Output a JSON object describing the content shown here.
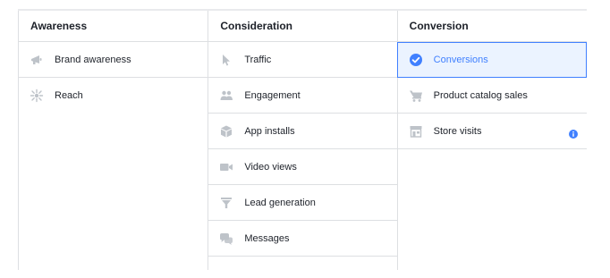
{
  "columns": {
    "awareness": {
      "title": "Awareness",
      "items": [
        {
          "label": "Brand awareness",
          "icon": "megaphone-icon"
        },
        {
          "label": "Reach",
          "icon": "reach-icon"
        }
      ]
    },
    "consideration": {
      "title": "Consideration",
      "items": [
        {
          "label": "Traffic",
          "icon": "cursor-icon"
        },
        {
          "label": "Engagement",
          "icon": "people-icon"
        },
        {
          "label": "App installs",
          "icon": "box-icon"
        },
        {
          "label": "Video views",
          "icon": "video-camera-icon"
        },
        {
          "label": "Lead generation",
          "icon": "funnel-icon"
        },
        {
          "label": "Messages",
          "icon": "chat-bubbles-icon"
        }
      ]
    },
    "conversion": {
      "title": "Conversion",
      "items": [
        {
          "label": "Conversions",
          "icon": "check-circle-icon",
          "selected": true
        },
        {
          "label": "Product catalog sales",
          "icon": "shopping-cart-icon"
        },
        {
          "label": "Store visits",
          "icon": "store-icon",
          "info": "info-icon"
        }
      ]
    }
  },
  "colors": {
    "accent": "#4080ff",
    "icon_gray": "#bec3c9",
    "border": "#dddfe2",
    "selected_bg": "#ebf3ff"
  }
}
